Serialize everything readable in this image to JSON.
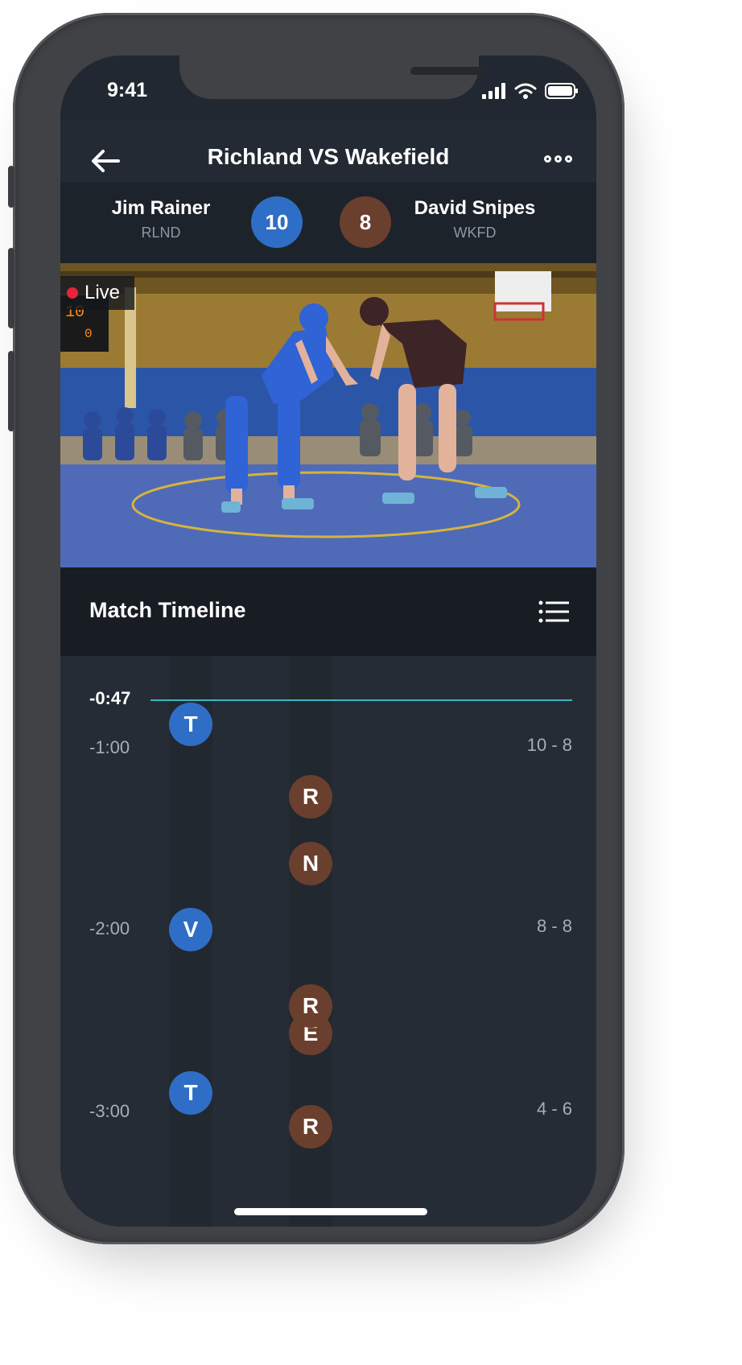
{
  "status_bar": {
    "time": "9:41"
  },
  "header": {
    "title": "Richland VS Wakefield"
  },
  "match": {
    "home": {
      "name": "Jim Rainer",
      "team": "RLND",
      "score": "10",
      "color": "#2f6ec6"
    },
    "away": {
      "name": "David Snipes",
      "team": "WKFD",
      "score": "8",
      "color": "#6b3f2d"
    }
  },
  "video": {
    "live_label": "Live"
  },
  "timeline": {
    "title": "Match Timeline",
    "current_time": "-0:47",
    "time_labels": [
      "-1:00",
      "-2:00",
      "-3:00"
    ],
    "score_labels": [
      "10 - 8",
      "8 - 8",
      "4 - 6"
    ],
    "events": [
      {
        "label": "T",
        "side": "home"
      },
      {
        "label": "R",
        "side": "away"
      },
      {
        "label": "N",
        "side": "away"
      },
      {
        "label": "V",
        "side": "home"
      },
      {
        "label": "R",
        "side": "away"
      },
      {
        "label": "E",
        "side": "away"
      },
      {
        "label": "T",
        "side": "home"
      },
      {
        "label": "R",
        "side": "away"
      }
    ]
  },
  "icons": [
    "back-arrow-icon",
    "more-options-icon",
    "list-icon",
    "signal-icon",
    "wifi-icon",
    "battery-icon",
    "live-dot-icon"
  ],
  "colors": {
    "accent_line": "#37b7c4",
    "home": "#2f6ec6",
    "away": "#6b3f2d",
    "live": "#e8223a"
  }
}
